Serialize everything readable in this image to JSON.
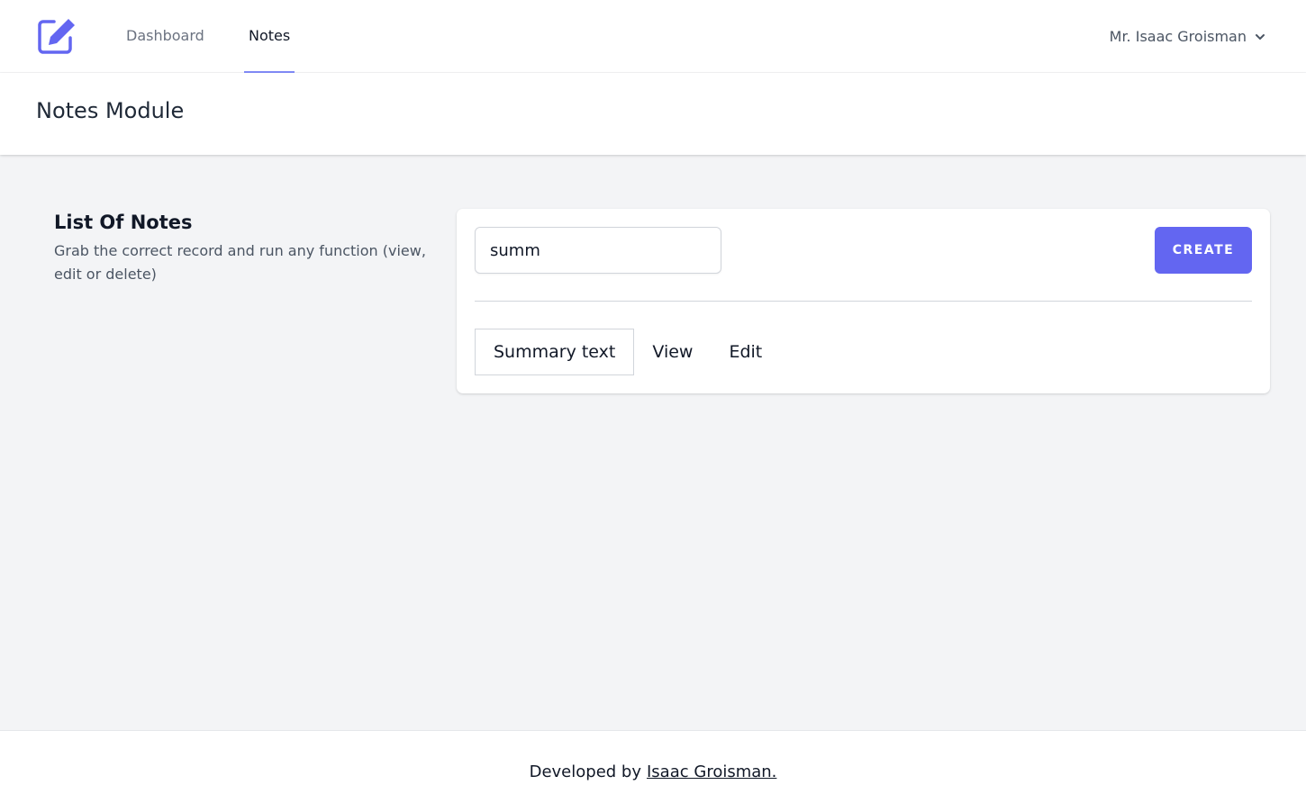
{
  "nav": {
    "logo_icon": "edit-note-icon",
    "items": [
      {
        "label": "Dashboard",
        "active": false
      },
      {
        "label": "Notes",
        "active": true
      }
    ],
    "user_name": "Mr. Isaac Groisman",
    "user_menu_icon": "chevron-down-icon",
    "accent_color": "#6366f1"
  },
  "header": {
    "title": "Notes Module"
  },
  "section": {
    "title": "List Of Notes",
    "description": "Grab the correct record and run any function (view, edit or delete)"
  },
  "card": {
    "search_value": "summ",
    "create_label": "CREATE",
    "rows": [
      {
        "summary": "Summary text",
        "view_label": "View",
        "edit_label": "Edit"
      }
    ]
  },
  "footer": {
    "prefix": "Developed by",
    "link_text": "Isaac Groisman."
  }
}
